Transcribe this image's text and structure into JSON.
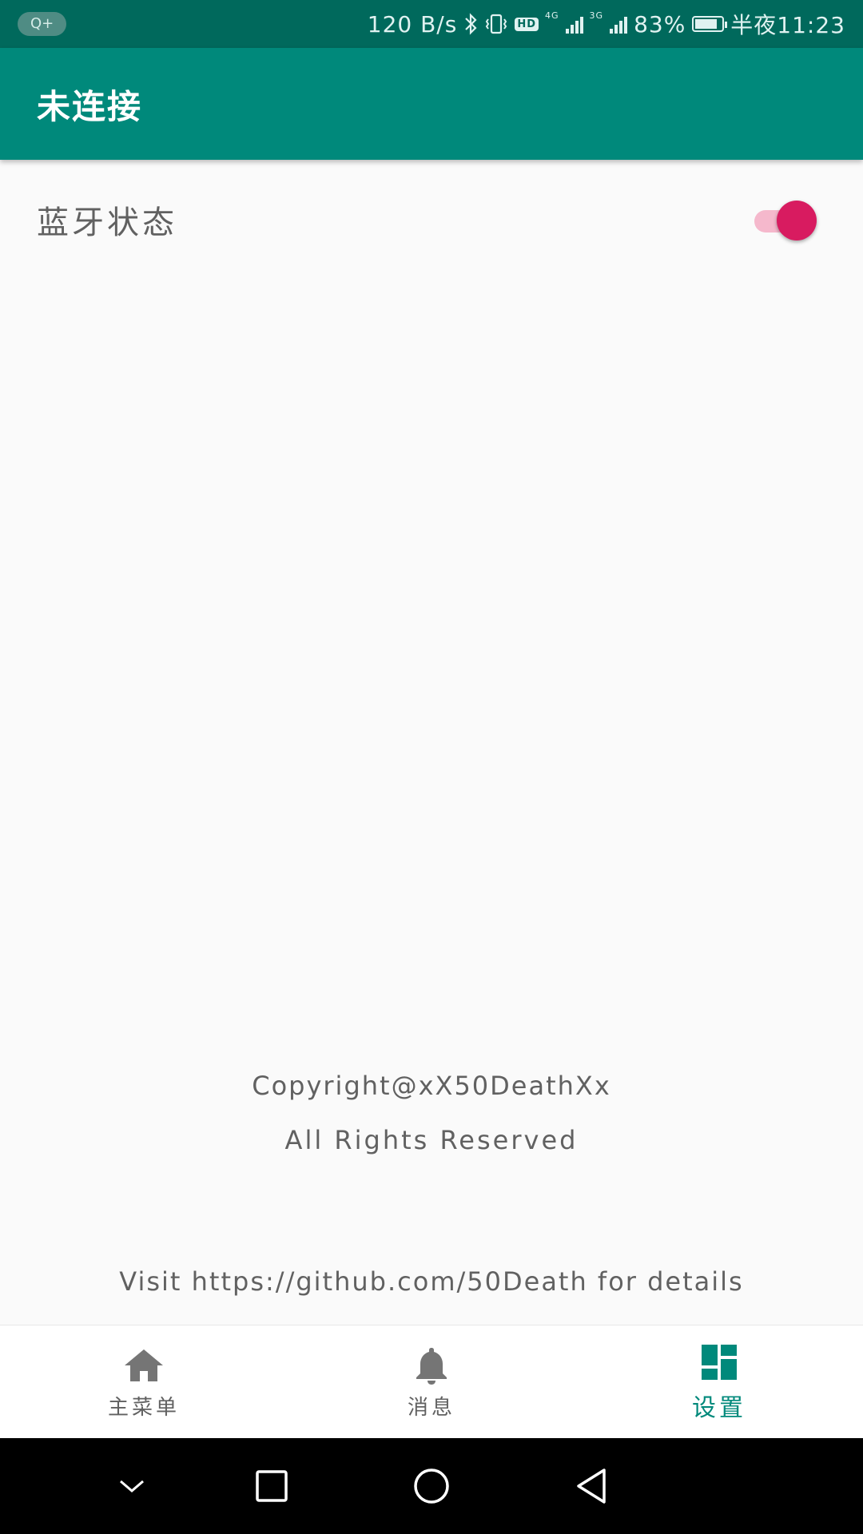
{
  "status_bar": {
    "badge": "Q+",
    "net_speed": "120 B/s",
    "network_4g": "4G",
    "network_3g": "3G",
    "hd": "HD",
    "battery": "83%",
    "battery_level": 0.83,
    "time": "半夜11:23"
  },
  "app_bar": {
    "title": "未连接"
  },
  "settings": {
    "bluetooth_label": "蓝牙状态",
    "bluetooth_on": true
  },
  "footer": {
    "copyright": "Copyright@xX50DeathXx",
    "rights": "All Rights Reserved",
    "visit": "Visit https://github.com/50Death for details"
  },
  "bottom_nav": {
    "items": [
      {
        "label": "主菜单",
        "icon": "home-icon",
        "active": false
      },
      {
        "label": "消息",
        "icon": "bell-icon",
        "active": false
      },
      {
        "label": "设置",
        "icon": "dashboard-icon",
        "active": true
      }
    ]
  },
  "colors": {
    "primary": "#00897b",
    "primary_dark": "#00695c",
    "accent": "#d81b60",
    "text_secondary": "#616161"
  },
  "system_nav": {
    "icons": [
      "chevron-down-icon",
      "recents-icon",
      "home-circle-icon",
      "back-icon"
    ]
  }
}
